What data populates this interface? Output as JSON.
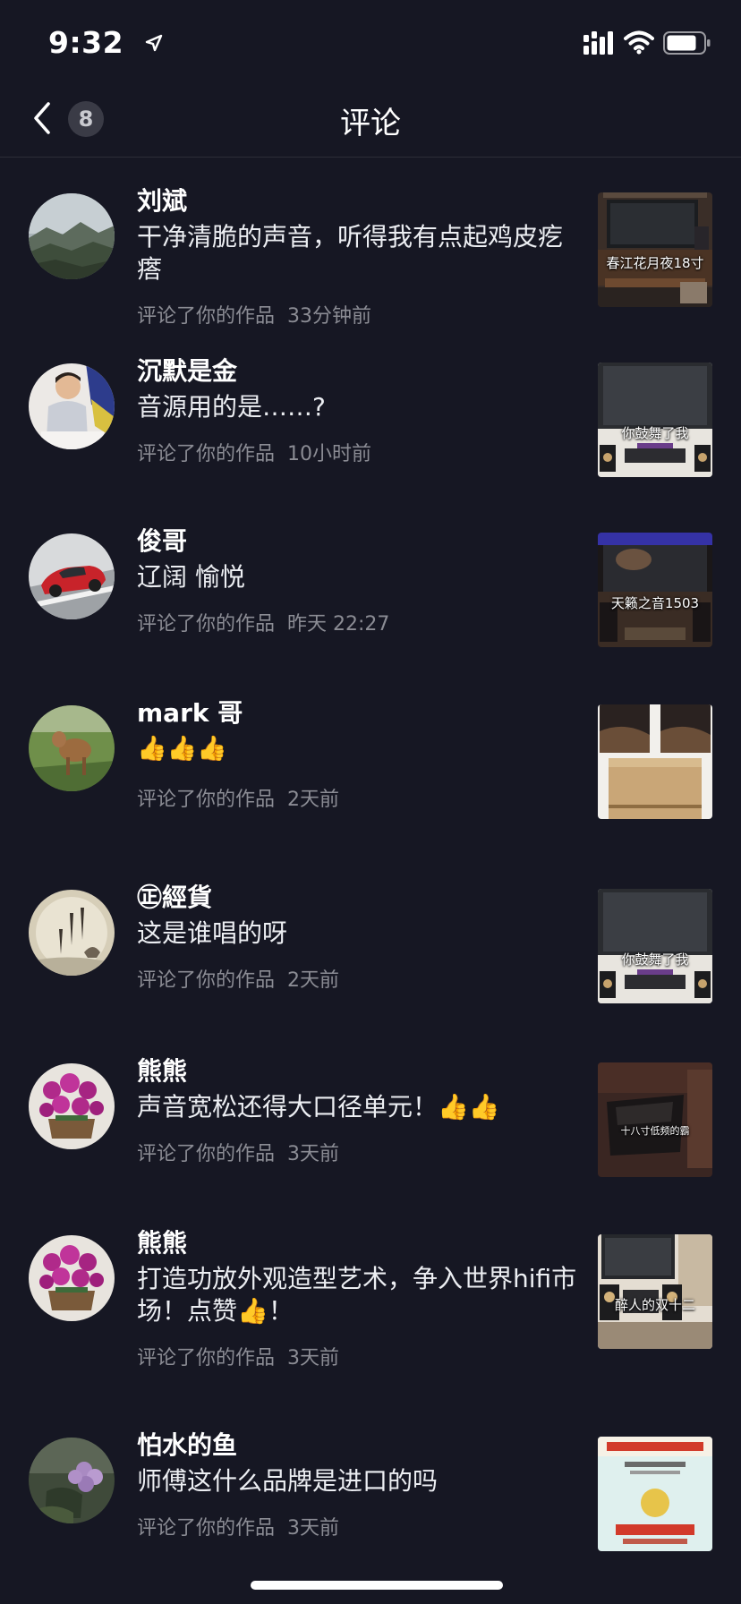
{
  "status_bar": {
    "time": "9:32"
  },
  "nav": {
    "badge_count": "8",
    "title": "评论"
  },
  "comments": [
    {
      "user": "刘斌",
      "text": "干净清脆的声音，听得我有点起鸡皮疙瘩",
      "action": "评论了你的作品",
      "time": "33分钟前",
      "thumb_label": "春江花月夜18寸",
      "avatar_icon": "mountain-avatar"
    },
    {
      "user": "沉默是金",
      "text": "音源用的是……?",
      "action": "评论了你的作品",
      "time": "10小时前",
      "thumb_label": "你鼓舞了我",
      "avatar_icon": "child-avatar"
    },
    {
      "user": "俊哥",
      "text": "辽阔 愉悦",
      "action": "评论了你的作品",
      "time": "昨天 22:27",
      "thumb_label": "天籁之音1503",
      "avatar_icon": "red-car-avatar"
    },
    {
      "user": "mark 哥",
      "text": "👍👍👍",
      "action": "评论了你的作品",
      "time": "2天前",
      "thumb_label": "",
      "avatar_icon": "deer-avatar"
    },
    {
      "user": "㊣經貨",
      "text": "这是谁唱的呀",
      "action": "评论了你的作品",
      "time": "2天前",
      "thumb_label": "你鼓舞了我",
      "avatar_icon": "calligraphy-avatar"
    },
    {
      "user": "熊熊",
      "text": "声音宽松还得大口径单元！👍👍",
      "action": "评论了你的作品",
      "time": "3天前",
      "thumb_label": "十八寸低频的霸",
      "avatar_icon": "orchid-avatar"
    },
    {
      "user": "熊熊",
      "text": "打造功放外观造型艺术，争入世界hifi市场！点赞👍！",
      "action": "评论了你的作品",
      "time": "3天前",
      "thumb_label": "醉人的双十二",
      "avatar_icon": "orchid-avatar"
    },
    {
      "user": "怕水的鱼",
      "text": "师傅这什么品牌是进口的吗",
      "action": "评论了你的作品",
      "time": "3天前",
      "thumb_label": "",
      "avatar_icon": "flower-avatar"
    }
  ]
}
